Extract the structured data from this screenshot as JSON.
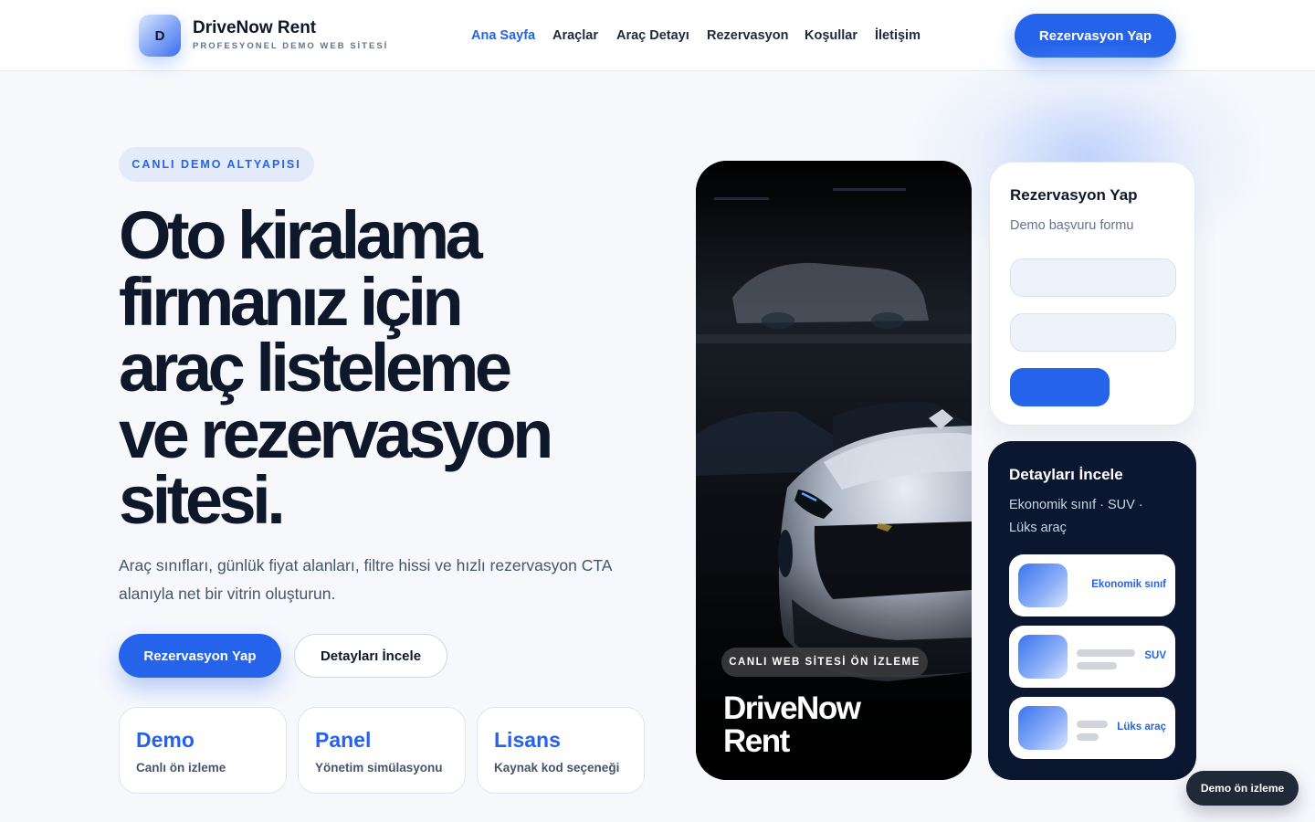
{
  "header": {
    "logo_letter": "D",
    "brand_name": "DriveNow Rent",
    "brand_subtitle": "PROFESYONEL DEMO WEB SİTESİ",
    "nav": [
      {
        "label": "Ana Sayfa",
        "active": true
      },
      {
        "label": "Araçlar",
        "active": false
      },
      {
        "label": "Araç Detayı",
        "active": false
      },
      {
        "label": "Rezervasyon",
        "active": false
      },
      {
        "label": "Koşullar",
        "active": false
      },
      {
        "label": "İletişim",
        "active": false
      }
    ],
    "cta_label": "Rezervasyon Yap"
  },
  "hero": {
    "badge": "CANLI DEMO ALTYAPISI",
    "title_lines": [
      "Oto kiralama",
      "firmanız için",
      "araç listeleme",
      "ve rezervasyon",
      "sitesi."
    ],
    "description": "Araç sınıfları, günlük fiyat alanları, filtre hissi ve hızlı rezervasyon CTA alanıyla net bir vitrin oluşturun.",
    "primary_button": "Rezervasyon Yap",
    "secondary_button": "Detayları İncele",
    "stats": [
      {
        "title": "Demo",
        "subtitle": "Canlı ön izleme"
      },
      {
        "title": "Panel",
        "subtitle": "Yönetim simülasyonu"
      },
      {
        "title": "Lisans",
        "subtitle": "Kaynak kod seçeneği"
      }
    ]
  },
  "preview": {
    "badge": "CANLI WEB SİTESİ ÖN İZLEME",
    "title_lines": [
      "DriveNow",
      "Rent"
    ]
  },
  "form_card": {
    "title": "Rezervasyon Yap",
    "subtitle": "Demo başvuru formu",
    "input1_value": "",
    "input2_value": ""
  },
  "detail_card": {
    "title": "Detayları İncele",
    "subtitle": "Ekonomik sınıf · SUV · Lüks araç",
    "categories": [
      {
        "label": "Ekonomik sınıf"
      },
      {
        "label": "SUV"
      },
      {
        "label": "Lüks araç"
      }
    ]
  },
  "floating_badge": "Demo ön izleme",
  "colors": {
    "accent": "#2563eb",
    "text_dark": "#0f172a",
    "dark_card": "#0b1730",
    "page_bg": "#f6f8fc"
  }
}
